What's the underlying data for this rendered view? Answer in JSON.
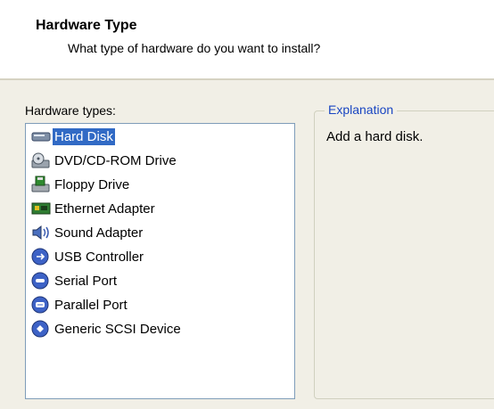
{
  "header": {
    "title": "Hardware Type",
    "subtitle": "What type of hardware do you want to install?"
  },
  "list": {
    "label": "Hardware types:",
    "items": [
      {
        "label": "Hard Disk",
        "icon": "hard-disk-icon",
        "selected": true
      },
      {
        "label": "DVD/CD-ROM Drive",
        "icon": "cd-drive-icon",
        "selected": false
      },
      {
        "label": "Floppy Drive",
        "icon": "floppy-drive-icon",
        "selected": false
      },
      {
        "label": "Ethernet Adapter",
        "icon": "network-adapter-icon",
        "selected": false
      },
      {
        "label": "Sound Adapter",
        "icon": "speaker-icon",
        "selected": false
      },
      {
        "label": "USB Controller",
        "icon": "usb-icon",
        "selected": false
      },
      {
        "label": "Serial Port",
        "icon": "serial-port-icon",
        "selected": false
      },
      {
        "label": "Parallel Port",
        "icon": "parallel-port-icon",
        "selected": false
      },
      {
        "label": "Generic SCSI Device",
        "icon": "scsi-icon",
        "selected": false
      }
    ]
  },
  "explanation": {
    "legend": "Explanation",
    "text": "Add a hard disk."
  },
  "colors": {
    "selection": "#316ac5",
    "legend": "#1a46c2",
    "background": "#f1efe6"
  }
}
